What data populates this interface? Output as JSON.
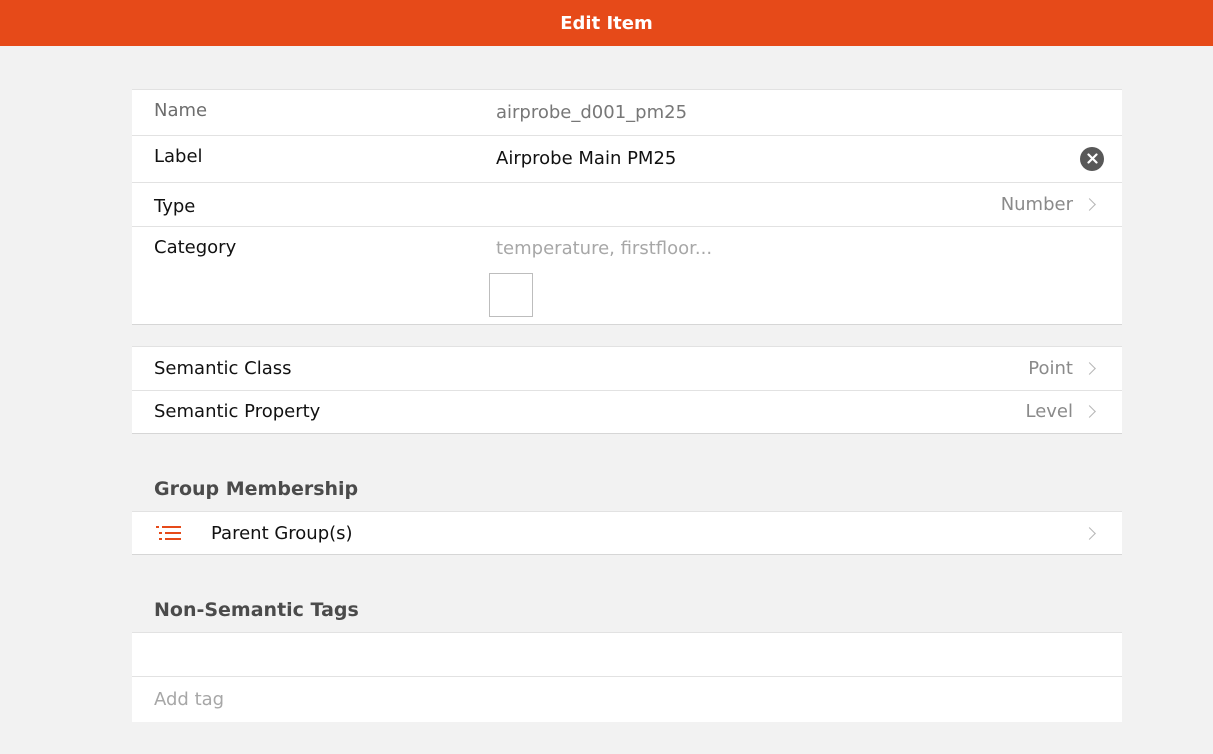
{
  "header": {
    "title": "Edit Item"
  },
  "item": {
    "name_label": "Name",
    "name_value": "airprobe_d001_pm25",
    "label_label": "Label",
    "label_value": "Airprobe Main PM25",
    "type_label": "Type",
    "type_value": "Number",
    "category_label": "Category",
    "category_placeholder": "temperature, firstfloor..."
  },
  "semantics": {
    "class_label": "Semantic Class",
    "class_value": "Point",
    "property_label": "Semantic Property",
    "property_value": "Level"
  },
  "group_membership": {
    "header": "Group Membership",
    "parent_groups_label": "Parent Group(s)"
  },
  "tags": {
    "header": "Non-Semantic Tags",
    "add_tag_placeholder": "Add tag"
  },
  "colors": {
    "accent": "#e64a19"
  }
}
